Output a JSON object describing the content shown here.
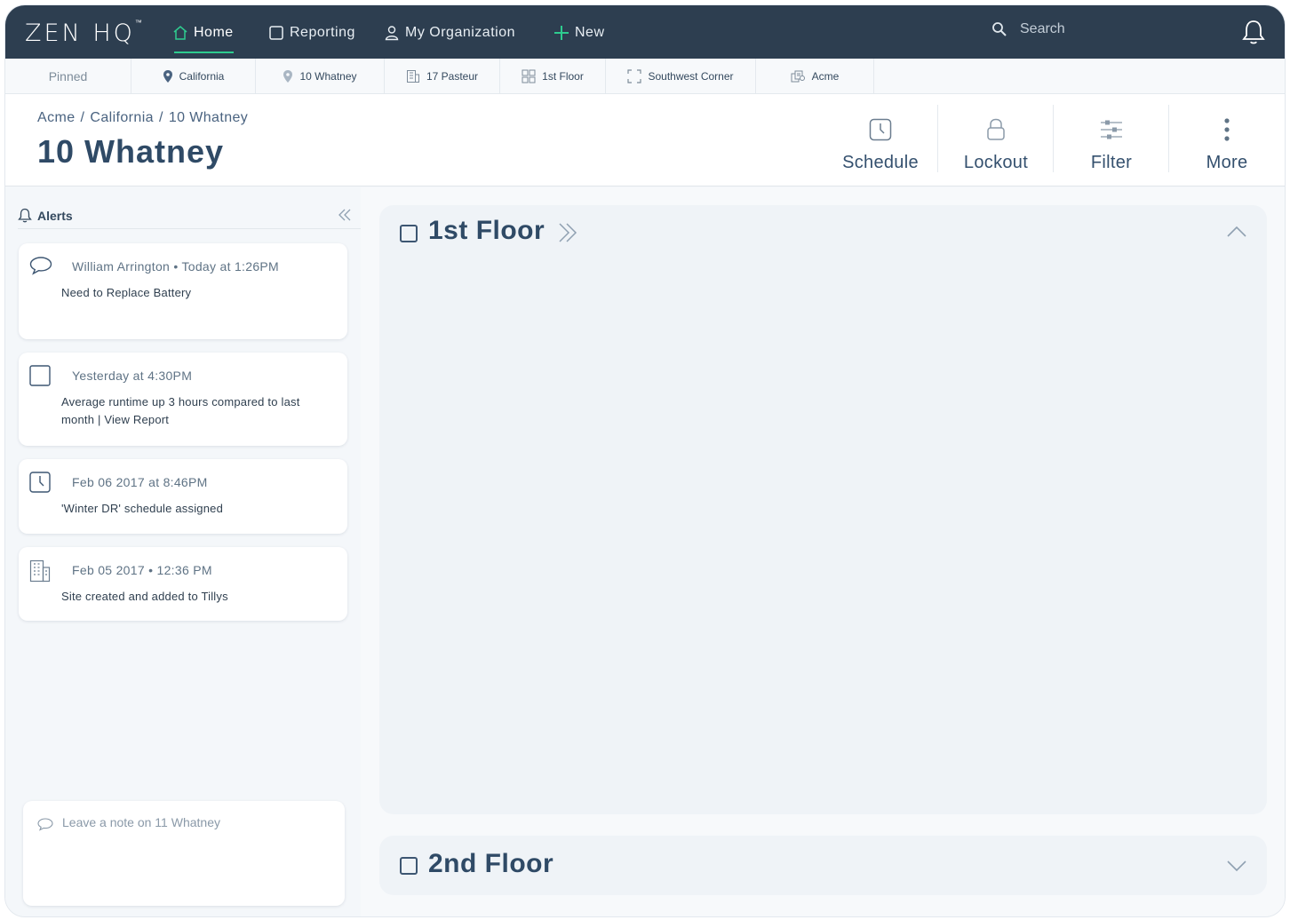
{
  "app": {
    "logo_text": "ZEN HQ",
    "logo_tm": "™"
  },
  "nav": {
    "home": "Home",
    "reporting": "Reporting",
    "organization": "My Organization",
    "new": "New",
    "search_placeholder": "Search"
  },
  "pinned": {
    "label": "Pinned",
    "items": [
      {
        "label": "California",
        "icon": "location-pin-icon"
      },
      {
        "label": "10 Whatney",
        "icon": "location-pin-outline-icon"
      },
      {
        "label": "17 Pasteur",
        "icon": "building-icon"
      },
      {
        "label": "1st Floor",
        "icon": "floor-grid-icon"
      },
      {
        "label": "Southwest Corner",
        "icon": "zone-corners-icon"
      },
      {
        "label": "Acme",
        "icon": "organization-icon"
      }
    ]
  },
  "header": {
    "breadcrumb": [
      "Acme",
      "California",
      "10 Whatney"
    ],
    "breadcrumb_separator": "/",
    "title": "10 Whatney",
    "actions": {
      "schedule": "Schedule",
      "lockout": "Lockout",
      "filter": "Filter",
      "more": "More"
    }
  },
  "alerts": {
    "title": "Alerts",
    "items": [
      {
        "meta": "William Arrington • Today at 1:26PM",
        "message": "Need to Replace Battery",
        "icon": "comment-icon"
      },
      {
        "meta": "Yesterday at 4:30PM",
        "message": "Average runtime up 3 hours compared to last month | View Report",
        "icon": "checkbox-icon"
      },
      {
        "meta": "Feb 06 2017 at 8:46PM",
        "message": "'Winter DR' schedule assigned",
        "icon": "clock-icon"
      },
      {
        "meta": "Feb 05 2017 • 12:36 PM",
        "message": "Site created and added to Tillys",
        "icon": "building-icon"
      }
    ],
    "note_placeholder": "Leave a note on 11 Whatney"
  },
  "floors": [
    {
      "title": "1st Floor",
      "expanded": true
    },
    {
      "title": "2nd Floor",
      "expanded": false
    }
  ],
  "colors": {
    "nav_bg": "#2d3e50",
    "accent": "#2ecc8f",
    "title": "#2f4a66"
  }
}
